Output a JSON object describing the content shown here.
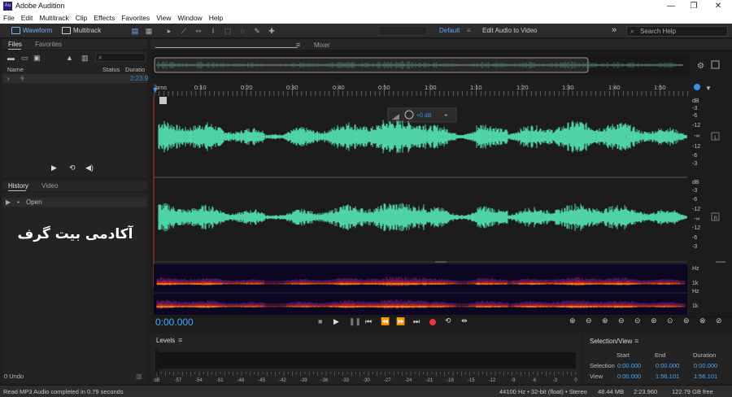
{
  "app": {
    "title": "Adobe Audition",
    "icon_text": "Au"
  },
  "window_controls": {
    "minimize": "—",
    "maximize": "❐",
    "close": "✕"
  },
  "menu": [
    "File",
    "Edit",
    "Multitrack",
    "Clip",
    "Effects",
    "Favorites",
    "View",
    "Window",
    "Help"
  ],
  "toolbar": {
    "waveform_label": "Waveform",
    "multitrack_label": "Multitrack",
    "default_label": "Default",
    "edit_video_label": "Edit Audio to Video",
    "search_placeholder": "Search Help",
    "chevron": "»"
  },
  "files_panel": {
    "tabs": [
      "Files",
      "Favorites"
    ],
    "columns": [
      "Name",
      "Status",
      "Duratio"
    ],
    "file_duration": "2:23.9"
  },
  "history_panel": {
    "tabs": [
      "History",
      "Video"
    ],
    "item": "Open",
    "undo_count": "0 Undo"
  },
  "watermark": "آکادمی بیت گرف",
  "editor": {
    "mixer_label": "Mixer",
    "hms_label": "hms",
    "time_ticks": [
      "0:10",
      "0:20",
      "0:30",
      "0:40",
      "0:50",
      "1:00",
      "1:10",
      "1:20",
      "1:30",
      "1:40",
      "1:50"
    ],
    "hud_gain": "+0 dB",
    "db_labels": [
      "dB",
      "-3",
      "-6",
      "-12",
      "-∞",
      "-12",
      "-6",
      "-3"
    ],
    "channel_left": "L",
    "channel_right": "R",
    "hz_label": "Hz",
    "khz_label": "1k",
    "current_time": "0:00.000"
  },
  "levels": {
    "title": "Levels",
    "scale": [
      "dB",
      "-57",
      "-54",
      "-51",
      "-48",
      "-45",
      "-42",
      "-39",
      "-36",
      "-33",
      "-30",
      "-27",
      "-24",
      "-21",
      "-18",
      "-15",
      "-12",
      "-9",
      "-6",
      "-3",
      "0"
    ]
  },
  "selection_view": {
    "title": "Selection/View",
    "columns": [
      "Start",
      "End",
      "Duration"
    ],
    "rows": [
      {
        "label": "Selection",
        "start": "0:00.000",
        "end": "0:00.000",
        "duration": "0:00.000"
      },
      {
        "label": "View",
        "start": "0:00.000",
        "end": "1:56.101",
        "duration": "1:56.101"
      }
    ]
  },
  "status": {
    "message": "Read MP3 Audio completed in 0.79 seconds",
    "format": "44100 Hz • 32-bit (float) • Stereo",
    "size": "48.44 MB",
    "duration": "2:23.960",
    "free": "122.79 GB free"
  },
  "colors": {
    "accent": "#2f8ee0",
    "waveform": "#4fd3a6",
    "playhead": "#3a8fe6",
    "record": "#e23b3b"
  }
}
